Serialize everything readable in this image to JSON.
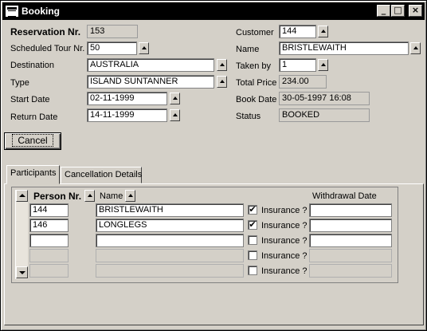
{
  "window": {
    "title": "Booking",
    "minimize_glyph": "_",
    "maximize_glyph": "□",
    "close_glyph": "×"
  },
  "form": {
    "reservation_nr": {
      "label": "Reservation Nr.",
      "value": "153"
    },
    "scheduled_tour_nr": {
      "label": "Scheduled Tour Nr.",
      "value": "50"
    },
    "destination": {
      "label": "Destination",
      "value": "AUSTRALIA"
    },
    "type": {
      "label": "Type",
      "value": "ISLAND SUNTANNER"
    },
    "start_date": {
      "label": "Start Date",
      "value": "02-11-1999"
    },
    "return_date": {
      "label": "Return Date",
      "value": "14-11-1999"
    },
    "customer": {
      "label": "Customer",
      "value": "144"
    },
    "name": {
      "label": "Name",
      "value": "BRISTLEWAITH"
    },
    "taken_by": {
      "label": "Taken by",
      "value": "1"
    },
    "total_price": {
      "label": "Total Price",
      "value": "234.00"
    },
    "book_date": {
      "label": "Book Date",
      "value": "30-05-1997 16:08"
    },
    "status": {
      "label": "Status",
      "value": "BOOKED"
    }
  },
  "cancel_button": "Cancel",
  "tabs": [
    {
      "label": "Participants",
      "active": true
    },
    {
      "label": "Cancellation Details",
      "active": false
    }
  ],
  "participants": {
    "headers": {
      "person_nr": "Person Nr.",
      "name": "Name",
      "withdrawal_date": "Withdrawal Date"
    },
    "insurance_label": "Insurance ?",
    "checkmark": "✔",
    "rows": [
      {
        "person_nr": "144",
        "name": "BRISTLEWAITH",
        "insurance": true,
        "withdrawal_date": ""
      },
      {
        "person_nr": "146",
        "name": "LONGLEGS",
        "insurance": true,
        "withdrawal_date": ""
      },
      {
        "person_nr": "",
        "name": "",
        "insurance": false,
        "withdrawal_date": ""
      },
      {
        "person_nr": "",
        "name": "",
        "insurance": false,
        "withdrawal_date": ""
      },
      {
        "person_nr": "",
        "name": "",
        "insurance": false,
        "withdrawal_date": ""
      }
    ]
  }
}
